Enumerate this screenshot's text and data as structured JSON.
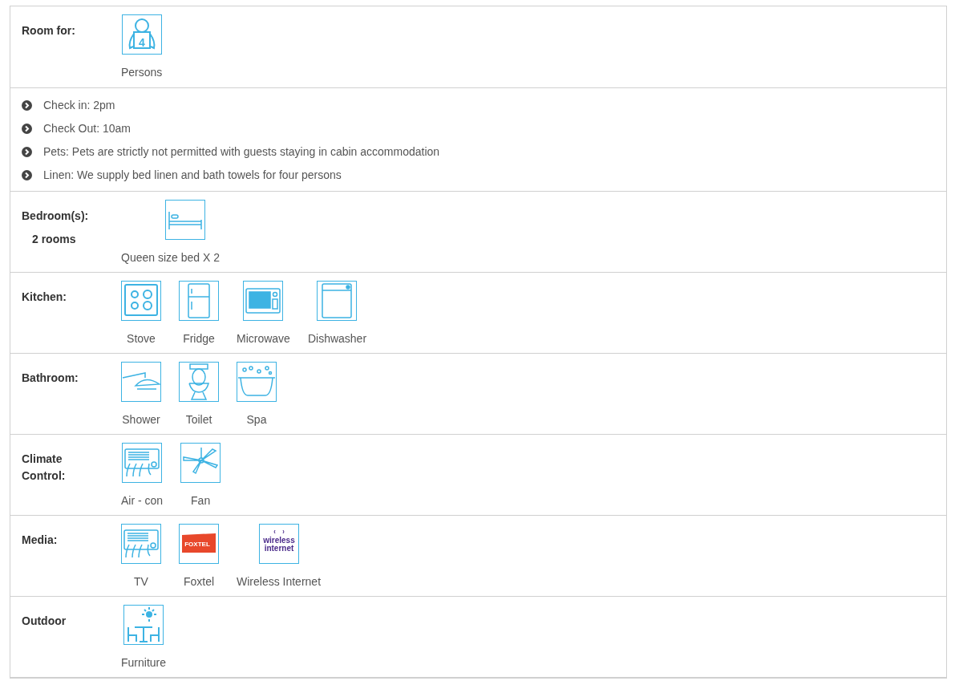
{
  "sections": [
    {
      "kind": "amenities",
      "label": "Room for:",
      "items": [
        {
          "kind": "person",
          "label": "Persons",
          "badge": "4"
        }
      ]
    },
    {
      "kind": "list",
      "items": [
        "Check in: 2pm",
        "Check Out: 10am",
        "Pets: Pets are strictly not permitted with guests staying in cabin accommodation",
        "Linen: We supply bed linen and bath towels for four persons"
      ]
    },
    {
      "kind": "amenities",
      "label": "Bedroom(s):",
      "sublabel": "2 rooms",
      "items": [
        {
          "kind": "bed",
          "label": "Queen size bed X 2"
        }
      ]
    },
    {
      "kind": "amenities",
      "label": "Kitchen:",
      "items": [
        {
          "kind": "stove",
          "label": "Stove"
        },
        {
          "kind": "fridge",
          "label": "Fridge"
        },
        {
          "kind": "microwave",
          "label": "Microwave"
        },
        {
          "kind": "dishwasher",
          "label": "Dishwasher"
        }
      ]
    },
    {
      "kind": "amenities",
      "label": "Bathroom:",
      "items": [
        {
          "kind": "shower",
          "label": "Shower"
        },
        {
          "kind": "toilet",
          "label": "Toilet"
        },
        {
          "kind": "spa",
          "label": "Spa"
        }
      ]
    },
    {
      "kind": "amenities",
      "label": "Climate Control:",
      "items": [
        {
          "kind": "aircon",
          "label": "Air - con"
        },
        {
          "kind": "fan",
          "label": "Fan"
        }
      ]
    },
    {
      "kind": "amenities",
      "label": "Media:",
      "items": [
        {
          "kind": "aircon",
          "label": "TV"
        },
        {
          "kind": "foxtel",
          "label": "Foxtel",
          "logo_lines": [
            "FOXTEL"
          ]
        },
        {
          "kind": "wireless",
          "label": "Wireless Internet",
          "logo_lines": [
            "wireless",
            "internet"
          ]
        }
      ]
    },
    {
      "kind": "amenities",
      "label": "Outdoor",
      "items": [
        {
          "kind": "furniture",
          "label": "Furniture"
        }
      ]
    }
  ]
}
